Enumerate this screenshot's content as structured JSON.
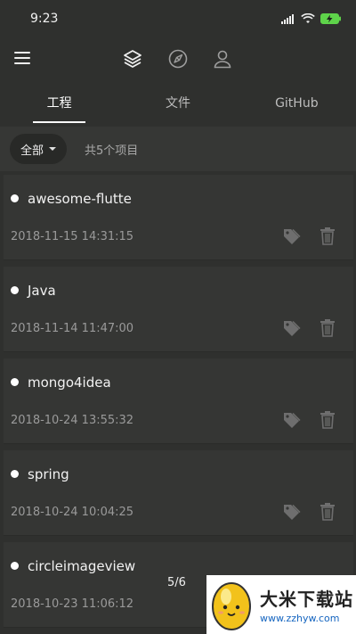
{
  "status_bar": {
    "time": "9:23"
  },
  "tabs": [
    {
      "label": "工程",
      "active": true
    },
    {
      "label": "文件",
      "active": false
    },
    {
      "label": "GitHub",
      "active": false
    }
  ],
  "filter": {
    "selected": "全部",
    "count_text": "共5个项目"
  },
  "projects": [
    {
      "name": "awesome-flutte",
      "date": "2018-11-15 14:31:15"
    },
    {
      "name": "Java",
      "date": "2018-11-14 11:47:00"
    },
    {
      "name": "mongo4idea",
      "date": "2018-10-24 13:55:32"
    },
    {
      "name": "spring",
      "date": "2018-10-24 10:04:25"
    },
    {
      "name": "circleimageview",
      "date": "2018-10-23 11:06:12"
    }
  ],
  "pager": {
    "text": "5/6"
  },
  "watermark": {
    "title": "大米下载站",
    "url": "www.zzhyw.com"
  },
  "colors": {
    "background": "#2f302e",
    "card": "#353634",
    "accent": "#ffffff"
  }
}
